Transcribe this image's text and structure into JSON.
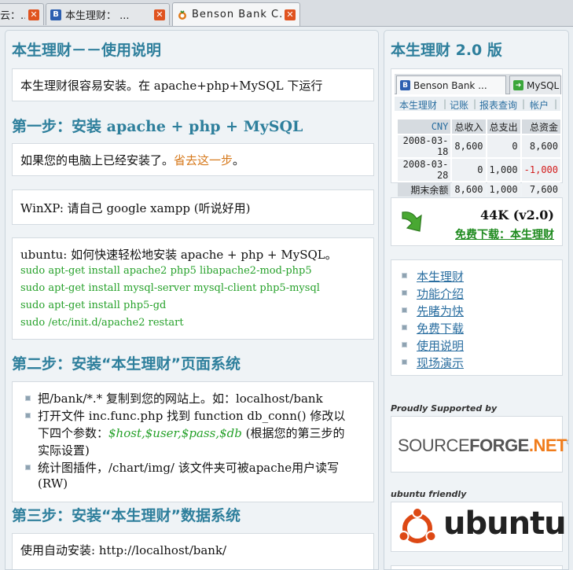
{
  "tabs": [
    {
      "title": "云：...",
      "icon": "tab-icon-generic"
    },
    {
      "title": "本生理财： ...",
      "icon": "benson-b-icon"
    },
    {
      "title": "Benson Bank C...",
      "icon": "benson-logo-icon"
    }
  ],
  "main": {
    "title": "本生理财－－使用说明",
    "intro_pre": "本生理财很容易安装。在",
    "intro_lat": "apache+php+MySQL",
    "intro_post": "下运行",
    "step1_pre": "第一步：安装",
    "step1_lat": "apache + php + MySQL",
    "step1_box1_text": "如果您的电脑上已经安装了。",
    "step1_box1_link": "省去这一步",
    "step1_box1_end": "。",
    "step1_box2": "WinXP: 请自己 google xampp (听说好用)",
    "step1_box3_title": "ubuntu: 如何快速轻松地安装 apache + php + MySQL。",
    "commands": [
      "sudo apt-get install apache2 php5 libapache2-mod-php5",
      "sudo apt-get install mysql-server mysql-client php5-mysql",
      "sudo apt-get install php5-gd",
      "sudo /etc/init.d/apache2 restart"
    ],
    "step2_title": "第二步：安装“本生理财”页面系统",
    "step2_items": {
      "a": "把/bank/*.* 复制到您的网站上。如：localhost/bank",
      "b_line1": "打开文件 inc.func.php 找到 function db_conn() 修改以",
      "b_line2_pre": "下四个参数：",
      "b_line2_vars": "$host,$user,$pass,$db",
      "b_line2_post": "(根据您的第三步的",
      "b_line3": "实际设置)",
      "c_line1": "统计图插件，/chart/img/ 该文件夹可被apache用户读写",
      "c_line2": "(RW)"
    },
    "step3_title": "第三步：安装“本生理财”数据系统",
    "step3_box": "使用自动安装: http://localhost/bank/"
  },
  "side": {
    "title": "本生理财 2.0 版",
    "mini_tabs": [
      "Benson Bank ...",
      "MySQL"
    ],
    "mini_nav": [
      "本生理财",
      "记账",
      "报表查询",
      "帐户"
    ],
    "table": {
      "headers": [
        "CNY",
        "总收入",
        "总支出",
        "总资金"
      ],
      "rows": [
        [
          "2008-03-18",
          "8,600",
          "0",
          "8,600"
        ],
        [
          "2008-03-28",
          "0",
          "1,000",
          "-1,000"
        ],
        [
          "期末余额",
          "8,600",
          "1,000",
          "7,600"
        ]
      ]
    },
    "download_size": "44K (v2.0)",
    "download_link": "免费下载：本生理财",
    "nav": [
      "本生理财",
      "功能介绍",
      "先睹为快",
      "免费下载",
      "使用说明",
      "现场演示"
    ],
    "supported_caption": "Proudly Supported by",
    "sourceforge": {
      "part1": "SOURCE",
      "part2": "FORGE",
      "part3": ".NET",
      "reg": "®"
    },
    "ubuntu_caption": "ubuntu friendly",
    "ubuntu_word": "ubuntu"
  }
}
